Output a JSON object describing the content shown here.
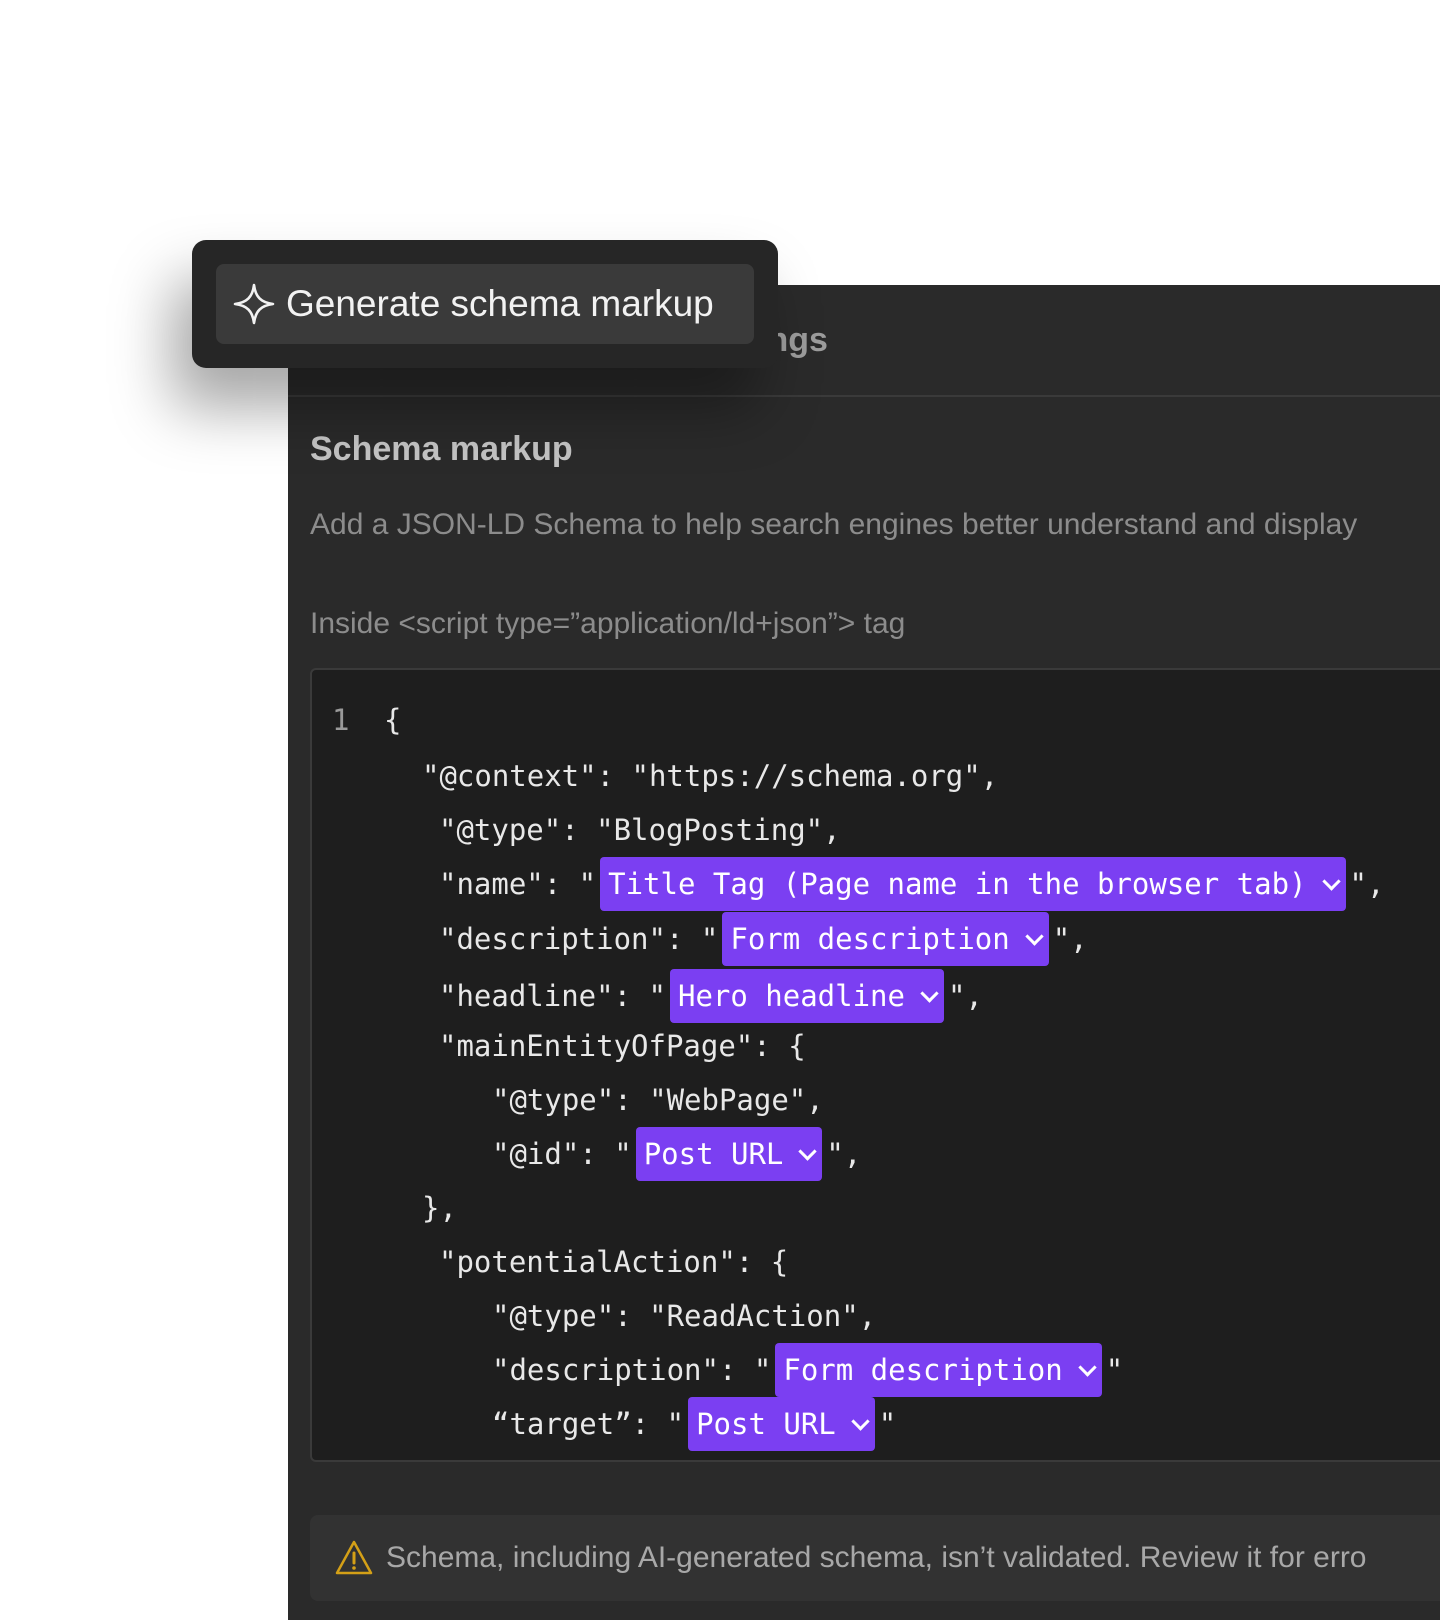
{
  "panel": {
    "header_title": "ings",
    "section_title": "Schema markup",
    "section_description": "Add a JSON-LD Schema to help search engines better understand and display",
    "code_label": "Inside <script type=”application/ld+json”> tag"
  },
  "editor": {
    "line_number": "1",
    "lines": {
      "l0": "{",
      "l1": "\"@context\": \"https://schema.org\",",
      "l2": "\"@type\": \"BlogPosting\",",
      "l3_pre": "\"name\": \"",
      "l3_token": "Title Tag (Page name in the browser tab)",
      "l3_post": "\",",
      "l4_pre": "\"description\": \"",
      "l4_token": "Form description",
      "l4_post": "\",",
      "l5_pre": "\"headline\": \"",
      "l5_token": "Hero headline",
      "l5_post": "\",",
      "l6": "\"mainEntityOfPage\": {",
      "l7": "\"@type\": \"WebPage\",",
      "l8_pre": "\"@id\": \"",
      "l8_token": "Post URL",
      "l8_post": "\",",
      "l9": "},",
      "l10": "\"potentialAction\": {",
      "l11": "\"@type\": \"ReadAction\",",
      "l12_pre": "\"description\": \"",
      "l12_token": "Form description",
      "l12_post": "\"",
      "l13_pre": "“target”: \"",
      "l13_token": "Post URL",
      "l13_post": "\""
    }
  },
  "warning": {
    "text": "Schema, including AI-generated schema, isn’t validated. Review it for erro"
  },
  "generate": {
    "label": "Generate schema markup",
    "icon": "sparkle-icon"
  },
  "colors": {
    "token_bg": "#7b3ff2",
    "panel_bg": "#2a2a2a",
    "editor_bg": "#1e1e1e"
  }
}
